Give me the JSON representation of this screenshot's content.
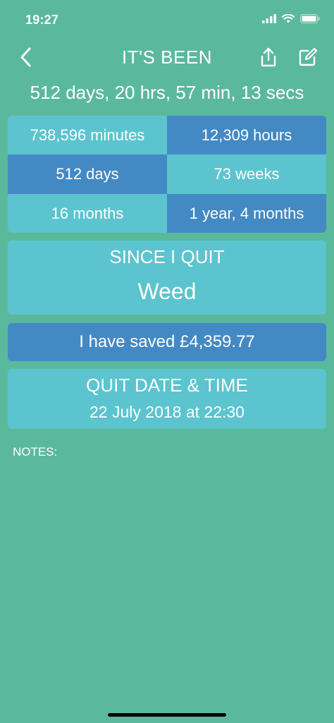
{
  "status_bar": {
    "time": "19:27"
  },
  "nav": {
    "title": "IT'S BEEN",
    "back_icon": "chevron-left-icon",
    "share_icon": "share-icon",
    "edit_icon": "edit-icon"
  },
  "elapsed": "512 days, 20 hrs, 57 min, 13 secs",
  "stats": [
    {
      "label": "738,596 minutes",
      "tone": "light"
    },
    {
      "label": "12,309 hours",
      "tone": "dark"
    },
    {
      "label": "512 days",
      "tone": "dark"
    },
    {
      "label": "73 weeks",
      "tone": "light"
    },
    {
      "label": "16 months",
      "tone": "light"
    },
    {
      "label": "1 year, 4 months",
      "tone": "dark"
    }
  ],
  "since": {
    "title": "SINCE I QUIT",
    "item": "Weed"
  },
  "saved": "I have saved £4,359.77",
  "quit_date": {
    "title": "QUIT DATE & TIME",
    "value": "22 July 2018 at 22:30"
  },
  "notes_label": "NOTES:",
  "colors": {
    "background": "#5bb99b",
    "light_tile": "#5bc4cf",
    "dark_tile": "#4389c4",
    "text": "#ffffff"
  }
}
